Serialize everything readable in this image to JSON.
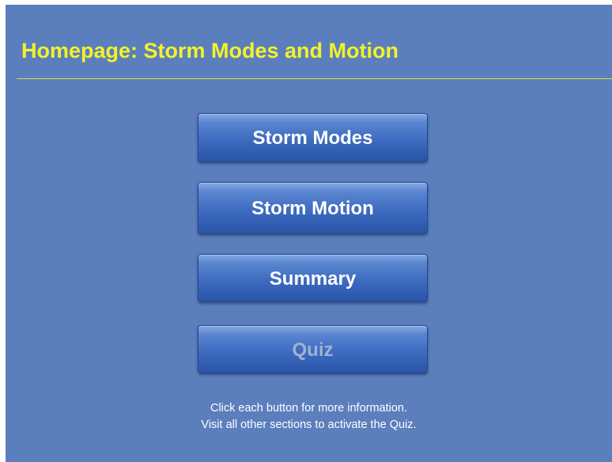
{
  "page": {
    "title": "Homepage: Storm Modes and Motion"
  },
  "colors": {
    "background": "#5b7fbd",
    "title": "#f4f22b",
    "button": "#3d6bc0",
    "button_text": "#ffffff",
    "disabled_text": "#9fb2d2"
  },
  "menu": {
    "storm_modes": "Storm Modes",
    "storm_motion": "Storm Motion",
    "summary": "Summary",
    "quiz": "Quiz"
  },
  "instructions": {
    "line1": "Click each button for more information.",
    "line2": "Visit all other sections to activate the Quiz."
  }
}
